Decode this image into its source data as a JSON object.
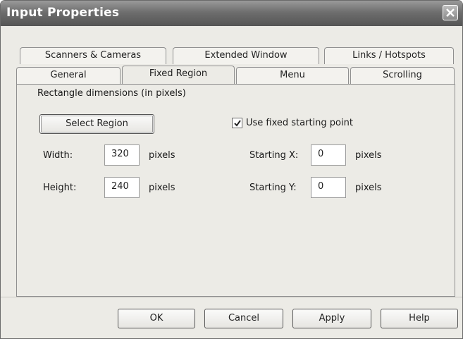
{
  "window": {
    "title": "Input Properties"
  },
  "tabs_top": [
    "Scanners & Cameras",
    "Extended Window",
    "Links / Hotspots"
  ],
  "tabs_bottom": [
    "General",
    "Fixed Region",
    "Menu",
    "Scrolling"
  ],
  "active_tab": "Fixed Region",
  "panel": {
    "group_label": "Rectangle dimensions (in pixels)",
    "select_region_label": "Select Region",
    "width_label": "Width:",
    "width_value": "320",
    "height_label": "Height:",
    "height_value": "240",
    "unit": "pixels",
    "use_fixed_label": "Use fixed starting point",
    "use_fixed_checked": true,
    "start_x_label": "Starting X:",
    "start_x_value": "0",
    "start_y_label": "Starting Y:",
    "start_y_value": "0"
  },
  "buttons": {
    "ok": "OK",
    "cancel": "Cancel",
    "apply": "Apply",
    "help": "Help"
  },
  "icons": {
    "close": "close-icon",
    "check": "checkmark-icon"
  }
}
